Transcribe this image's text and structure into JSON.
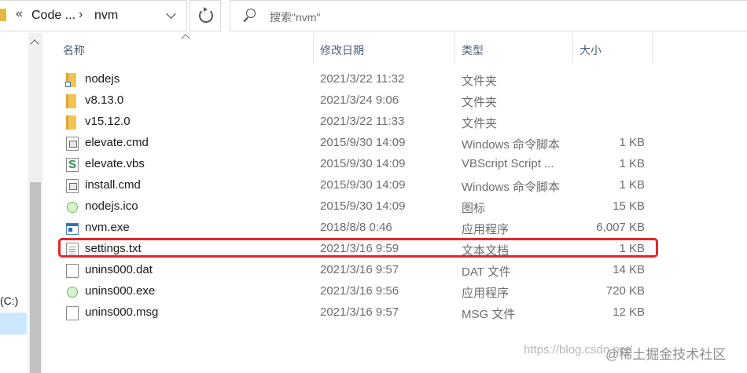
{
  "address": {
    "breadcrumb_prefix": "«",
    "code_segment": "Code ...",
    "separator": "›",
    "current_folder": "nvm"
  },
  "search": {
    "placeholder": "搜索\"nvm\""
  },
  "nav": {
    "drive_label": "(C:)"
  },
  "columns": {
    "name": "名称",
    "date": "修改日期",
    "type": "类型",
    "size": "大小"
  },
  "files": [
    {
      "name": "nodejs",
      "date": "2021/3/22 11:32",
      "type": "文件夹",
      "size": "",
      "icon": "folder-shortcut-icon"
    },
    {
      "name": "v8.13.0",
      "date": "2021/3/24 9:06",
      "type": "文件夹",
      "size": "",
      "icon": "folder-icon"
    },
    {
      "name": "v15.12.0",
      "date": "2021/3/22 11:33",
      "type": "文件夹",
      "size": "",
      "icon": "folder-icon"
    },
    {
      "name": "elevate.cmd",
      "date": "2015/9/30 14:09",
      "type": "Windows 命令脚本",
      "size": "1 KB",
      "icon": "cmd-file-icon"
    },
    {
      "name": "elevate.vbs",
      "date": "2015/9/30 14:09",
      "type": "VBScript Script ...",
      "size": "1 KB",
      "icon": "vbs-file-icon"
    },
    {
      "name": "install.cmd",
      "date": "2015/9/30 14:09",
      "type": "Windows 命令脚本",
      "size": "1 KB",
      "icon": "cmd-file-icon"
    },
    {
      "name": "nodejs.ico",
      "date": "2015/9/30 14:09",
      "type": "图标",
      "size": "15 KB",
      "icon": "nodejs-ico-icon"
    },
    {
      "name": "nvm.exe",
      "date": "2018/8/8 0:46",
      "type": "应用程序",
      "size": "6,007 KB",
      "icon": "exe-file-icon"
    },
    {
      "name": "settings.txt",
      "date": "2021/3/16 9:59",
      "type": "文本文档",
      "size": "1 KB",
      "icon": "text-file-icon"
    },
    {
      "name": "unins000.dat",
      "date": "2021/3/16 9:57",
      "type": "DAT 文件",
      "size": "14 KB",
      "icon": "dat-file-icon"
    },
    {
      "name": "unins000.exe",
      "date": "2021/3/16 9:56",
      "type": "应用程序",
      "size": "720 KB",
      "icon": "installer-exe-icon"
    },
    {
      "name": "unins000.msg",
      "date": "2021/3/16 9:57",
      "type": "MSG 文件",
      "size": "12 KB",
      "icon": "msg-file-icon"
    }
  ],
  "highlight": {
    "color": "#e4262b",
    "target": "settings.txt"
  },
  "watermark": {
    "url_text": "https://blog.csdn.net/",
    "brand": "@稀土掘金技术社区"
  }
}
